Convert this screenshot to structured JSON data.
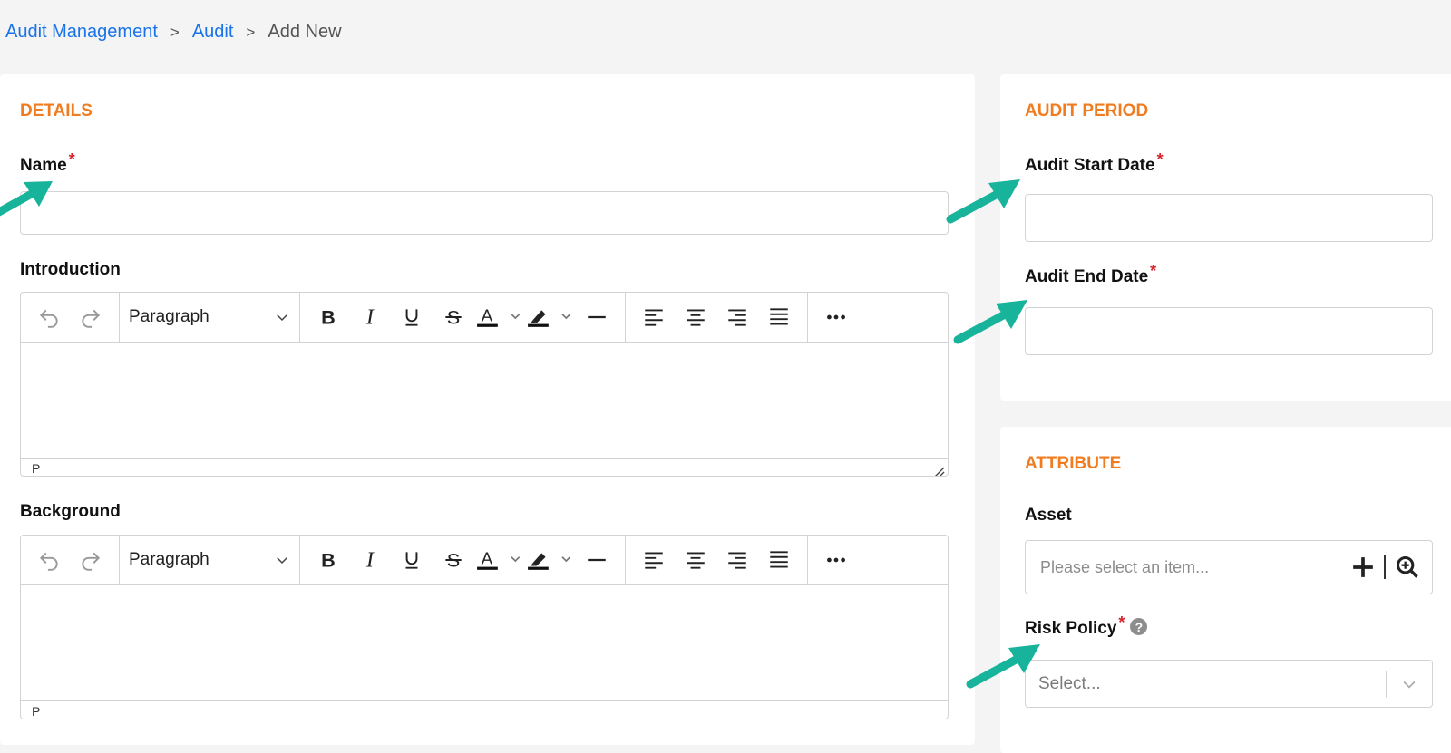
{
  "breadcrumb": {
    "items": [
      "Audit Management",
      "Audit"
    ],
    "separator": ">",
    "current": "Add New"
  },
  "details": {
    "title": "DETAILS",
    "name_label": "Name",
    "name_value": "",
    "introduction_label": "Introduction",
    "background_label": "Background",
    "editor": {
      "block_format": "Paragraph",
      "status_path": "P",
      "tools": [
        "undo-icon",
        "redo-icon",
        "bold-icon",
        "italic-icon",
        "underline-icon",
        "strikethrough-icon",
        "text-color-icon",
        "highlight-icon",
        "horizontal-line-icon",
        "align-left-icon",
        "align-center-icon",
        "align-right-icon",
        "justify-icon",
        "more-icon"
      ]
    }
  },
  "audit_period": {
    "title": "AUDIT PERIOD",
    "start_label": "Audit Start Date",
    "start_value": "",
    "end_label": "Audit End Date",
    "end_value": ""
  },
  "attribute": {
    "title": "ATTRIBUTE",
    "asset_label": "Asset",
    "asset_placeholder": "Please select an item...",
    "risk_policy_label": "Risk Policy",
    "risk_policy_help": "?",
    "risk_policy_value": "Select..."
  },
  "required_marker": "*",
  "colors": {
    "accent_orange": "#f07c1f",
    "link_blue": "#1a73e8",
    "required_red": "#d9232d",
    "annotation_arrow": "#17b39a"
  }
}
